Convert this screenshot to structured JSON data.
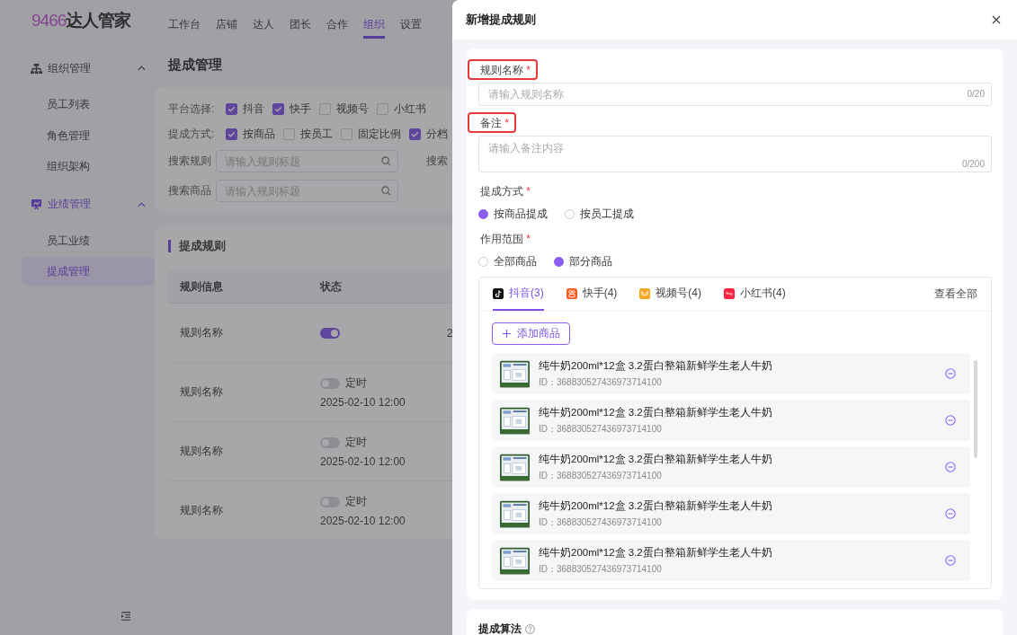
{
  "app": {
    "logo_number": "9466",
    "logo_text": "达人管家"
  },
  "top_nav": [
    {
      "label": "工作台",
      "selected": false
    },
    {
      "label": "店铺",
      "selected": false
    },
    {
      "label": "达人",
      "selected": false
    },
    {
      "label": "团长",
      "selected": false
    },
    {
      "label": "合作",
      "selected": false
    },
    {
      "label": "组织",
      "selected": true
    },
    {
      "label": "设置",
      "selected": false
    }
  ],
  "sidebar": {
    "groups": [
      {
        "label": "组织管理",
        "kind": "org",
        "expanded": true,
        "active": false,
        "children": [
          {
            "label": "员工列表",
            "selected": false
          },
          {
            "label": "角色管理",
            "selected": false
          },
          {
            "label": "组织架构",
            "selected": false
          }
        ]
      },
      {
        "label": "业绩管理",
        "kind": "perf",
        "expanded": true,
        "active": true,
        "children": [
          {
            "label": "员工业绩",
            "selected": false
          },
          {
            "label": "提成管理",
            "selected": true
          }
        ]
      }
    ]
  },
  "page": {
    "title": "提成管理",
    "filters": {
      "platform": {
        "label": "平台选择:",
        "options": [
          {
            "label": "抖音",
            "checked": true
          },
          {
            "label": "快手",
            "checked": true
          },
          {
            "label": "视频号",
            "checked": false
          },
          {
            "label": "小红书",
            "checked": false
          }
        ]
      },
      "method": {
        "label": "提成方式:",
        "options": [
          {
            "label": "按商品",
            "checked": true
          },
          {
            "label": "按员工",
            "checked": false
          },
          {
            "label": "固定比例",
            "checked": false
          },
          {
            "label": "分档",
            "checked": true
          }
        ]
      },
      "search_rule": {
        "label": "搜索规则",
        "placeholder": "请输入规则标题"
      },
      "search_cut_label": "搜索",
      "search_product": {
        "label": "搜索商品",
        "placeholder": "请输入规则标题"
      }
    },
    "rules": {
      "title": "提成规则",
      "columns": [
        "规则信息",
        "状态"
      ],
      "rows": [
        {
          "name": "规则名称",
          "on": true,
          "column_3": "2"
        },
        {
          "name": "规则名称",
          "on": false,
          "schedule_label": "定时",
          "time": "2025-02-10 12:00"
        },
        {
          "name": "规则名称",
          "on": false,
          "schedule_label": "定时",
          "time": "2025-02-10 12:00"
        },
        {
          "name": "规则名称",
          "on": false,
          "schedule_label": "定时",
          "time": "2025-02-10 12:00"
        }
      ]
    }
  },
  "drawer": {
    "title": "新增提成规则",
    "name_field": {
      "label": "规则名称",
      "required_mark": "*",
      "highlighted": true,
      "placeholder": "请输入规则名称",
      "counter": "0/20"
    },
    "note_field": {
      "label": "备注",
      "required_mark": "*",
      "highlighted": true,
      "placeholder": "请输入备注内容",
      "counter": "0/200"
    },
    "method": {
      "label": "提成方式",
      "required_mark": "*",
      "options": [
        {
          "label": "按商品提成",
          "selected": true
        },
        {
          "label": "按员工提成",
          "selected": false
        }
      ]
    },
    "scope": {
      "label": "作用范围",
      "required_mark": "*",
      "options": [
        {
          "label": "全部商品",
          "selected": false
        },
        {
          "label": "部分商品",
          "selected": true
        }
      ]
    },
    "platform_tabs": [
      {
        "label": "抖音(3)",
        "kind": "douyin",
        "selected": true
      },
      {
        "label": "快手(4)",
        "kind": "kuaishou",
        "selected": false
      },
      {
        "label": "视频号(4)",
        "kind": "channels",
        "selected": false
      },
      {
        "label": "小红书(4)",
        "kind": "xiaohongshu",
        "selected": false
      }
    ],
    "view_all": "查看全部",
    "add_button": "添加商品",
    "products": [
      {
        "name": "纯牛奶200ml*12盒 3.2蛋白整箱新鲜学生老人牛奶",
        "id": "ID：368830527436973714100"
      },
      {
        "name": "纯牛奶200ml*12盒 3.2蛋白整箱新鲜学生老人牛奶",
        "id": "ID：368830527436973714100"
      },
      {
        "name": "纯牛奶200ml*12盒 3.2蛋白整箱新鲜学生老人牛奶",
        "id": "ID：368830527436973714100"
      },
      {
        "name": "纯牛奶200ml*12盒 3.2蛋白整箱新鲜学生老人牛奶",
        "id": "ID：368830527436973714100"
      },
      {
        "name": "纯牛奶200ml*12盒 3.2蛋白整箱新鲜学生老人牛奶",
        "id": "ID：368830527436973714100"
      }
    ],
    "algorithm_title": "提成算法"
  }
}
